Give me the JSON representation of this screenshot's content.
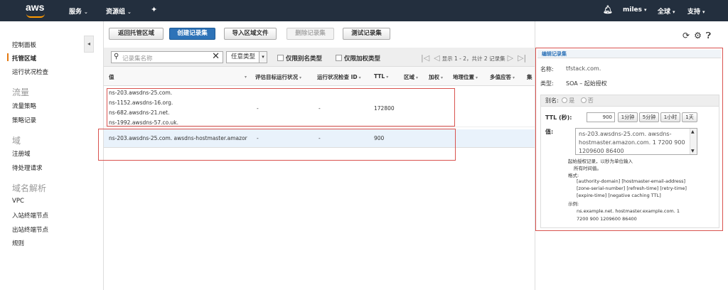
{
  "topbar": {
    "logo": "aws",
    "services": "服务",
    "resource_groups": "资源组",
    "user": "miles",
    "region": "全球",
    "support": "支持"
  },
  "sidebar": {
    "items": [
      {
        "label": "控制面板"
      },
      {
        "label": "托管区域"
      },
      {
        "label": "运行状况检查"
      }
    ],
    "section_traffic": "流量",
    "traffic_items": [
      {
        "label": "流量策略"
      },
      {
        "label": "策略记录"
      }
    ],
    "section_domains": "域",
    "domain_items": [
      {
        "label": "注册域"
      },
      {
        "label": "待处理请求"
      }
    ],
    "section_resolver": "域名解析",
    "resolver_items": [
      {
        "label": "VPC"
      },
      {
        "label": "入站终端节点"
      },
      {
        "label": "出站终端节点"
      },
      {
        "label": "规则"
      }
    ]
  },
  "toolbar": {
    "back": "返回托管区域",
    "create": "创建记录集",
    "import": "导入区域文件",
    "delete": "删除记录集",
    "test": "测试记录集"
  },
  "filter": {
    "search_placeholder": "记录集名称",
    "type": "任意类型",
    "alias_only": "仅限别名类型",
    "weighted_only": "仅限加权类型",
    "paging": "显示 1 - 2，共计 2 记录集"
  },
  "table": {
    "columns": [
      "值",
      "评估目标运行状况",
      "运行状况检查 ID",
      "TTL",
      "区域",
      "加权",
      "地理位置",
      "多值应答",
      "集"
    ],
    "rows": [
      {
        "values": [
          "ns-203.awsdns-25.com.",
          "ns-1152.awsdns-16.org.",
          "ns-682.awsdns-21.net.",
          "ns-1992.awsdns-57.co.uk."
        ],
        "eval": "-",
        "health": "-",
        "ttl": "172800"
      },
      {
        "values": [
          "ns-203.awsdns-25.com. awsdns-hostmaster.amazor"
        ],
        "eval": "-",
        "health": "-",
        "ttl": "900"
      }
    ]
  },
  "editor": {
    "header": "编辑记录集",
    "name_label": "名称:",
    "name_value": "tfstack.com.",
    "type_label": "类型:",
    "type_value": "SOA – 起始授权",
    "alias_label": "别名:",
    "alias_yes": "是",
    "alias_no": "否",
    "ttl_label": "TTL (秒):",
    "ttl_value": "900",
    "ttl_buttons": [
      "1分钟",
      "5分钟",
      "1小时",
      "1天"
    ],
    "value_label": "值:",
    "value_lines": [
      "ns-203.awsdns-25.com. awsdns-",
      "hostmaster.amazon.com. 1 7200 900",
      "1209600 86400"
    ],
    "help": [
      "起始授权记录，以秒为单位输入",
      "所有时间值。",
      "格式:",
      "[authority-domain] [hostmaster-email-address]",
      "[zone-serial-number] [refresh-time] [retry-time]",
      "[expire-time] [negative caching TTL]",
      "示例:",
      "ns.example.net. hostmaster.example.com. 1",
      "7200 900 1209600 86400"
    ]
  }
}
